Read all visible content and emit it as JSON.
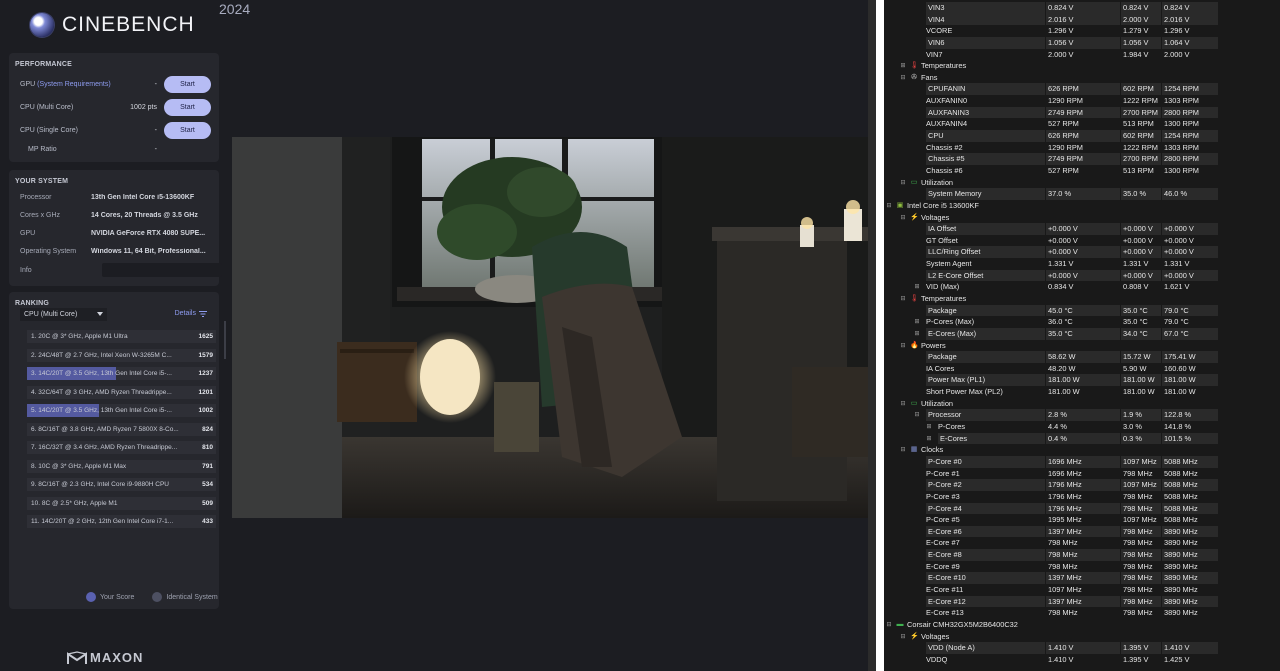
{
  "app": {
    "name": "CINEBENCH",
    "year": "2024",
    "footer_brand": "MAXON"
  },
  "performance": {
    "title": "PERFORMANCE",
    "rows": [
      {
        "label_prefix": "GPU ",
        "label_link": "(System Requirements)",
        "score": "-",
        "button": "Start"
      },
      {
        "label_prefix": "CPU (Multi Core)",
        "label_link": "",
        "score": "1002 pts",
        "button": "Start"
      },
      {
        "label_prefix": "CPU (Single Core)",
        "label_link": "",
        "score": "-",
        "button": "Start"
      },
      {
        "label_prefix": "MP Ratio",
        "label_link": "",
        "score": "-",
        "button": ""
      }
    ]
  },
  "system": {
    "title": "YOUR SYSTEM",
    "rows": [
      {
        "label": "Processor",
        "value": "13th Gen Intel Core i5-13600KF"
      },
      {
        "label": "Cores x GHz",
        "value": "14 Cores, 20 Threads @ 3.5 GHz"
      },
      {
        "label": "GPU",
        "value": "NVIDIA GeForce RTX 4080 SUPE..."
      },
      {
        "label": "Operating System",
        "value": "Windows 11, 64 Bit, Professional..."
      },
      {
        "label": "Info",
        "value": ""
      }
    ]
  },
  "ranking": {
    "title": "RANKING",
    "selected": "CPU (Multi Core)",
    "details": "Details",
    "max_score": 1625,
    "rows": [
      {
        "text": "1. 20C @ 3* GHz, Apple M1 Ultra",
        "score": "1625",
        "value": 1625,
        "mine": false
      },
      {
        "text": "2. 24C/48T @ 2.7 GHz, Intel Xeon W-3265M C...",
        "score": "1579",
        "value": 1579,
        "mine": false
      },
      {
        "text": "3. 14C/20T @ 3.5 GHz, 13th Gen Intel Core i5-...",
        "score": "1237",
        "value": 1237,
        "mine": true
      },
      {
        "text": "4. 32C/64T @ 3 GHz, AMD Ryzen Threadrippe...",
        "score": "1201",
        "value": 1201,
        "mine": false
      },
      {
        "text": "5. 14C/20T @ 3.5 GHz, 13th Gen Intel Core i5-...",
        "score": "1002",
        "value": 1002,
        "mine": true
      },
      {
        "text": "6. 8C/16T @ 3.8 GHz, AMD Ryzen 7 5800X 8-Co...",
        "score": "824",
        "value": 824,
        "mine": false
      },
      {
        "text": "7. 16C/32T @ 3.4 GHz, AMD Ryzen Threadrippe...",
        "score": "810",
        "value": 810,
        "mine": false
      },
      {
        "text": "8. 10C @ 3* GHz, Apple M1 Max",
        "score": "791",
        "value": 791,
        "mine": false
      },
      {
        "text": "9. 8C/16T @ 2.3 GHz, Intel Core i9-9880H CPU",
        "score": "534",
        "value": 534,
        "mine": false
      },
      {
        "text": "10. 8C @ 2.5* GHz, Apple M1",
        "score": "509",
        "value": 509,
        "mine": false
      },
      {
        "text": "11. 14C/20T @ 2 GHz, 12th Gen Intel Core i7-1...",
        "score": "433",
        "value": 433,
        "mine": false
      }
    ],
    "legend": {
      "your_score": "Your Score",
      "identical": "Identical System"
    }
  },
  "colors": {
    "accent": "#b6bcf4",
    "your_score": "#545aa0",
    "identical": "#6a6e86"
  },
  "sensors": [
    {
      "indent": 3,
      "name": "VIN3",
      "v1": "0.824 V",
      "v2": "0.824 V",
      "v3": "0.824 V",
      "hl": true
    },
    {
      "indent": 3,
      "name": "VIN4",
      "v1": "2.016 V",
      "v2": "2.000 V",
      "v3": "2.016 V",
      "hl": true
    },
    {
      "indent": 3,
      "name": "VCORE",
      "v1": "1.296 V",
      "v2": "1.279 V",
      "v3": "1.296 V",
      "hl": false
    },
    {
      "indent": 3,
      "name": "VIN6",
      "v1": "1.056 V",
      "v2": "1.056 V",
      "v3": "1.064 V",
      "hl": true
    },
    {
      "indent": 3,
      "name": "VIN7",
      "v1": "2.000 V",
      "v2": "1.984 V",
      "v3": "2.000 V",
      "hl": false
    },
    {
      "indent": 2,
      "name": "Temperatures",
      "group": true,
      "toggle": "+",
      "icon": "thermometer-icon",
      "glyph": "🌡",
      "color": "#e04040"
    },
    {
      "indent": 2,
      "name": "Fans",
      "group": true,
      "toggle": "−",
      "icon": "fan-icon",
      "glyph": "✇",
      "color": "#cccccc"
    },
    {
      "indent": 3,
      "name": "CPUFANIN",
      "v1": "626 RPM",
      "v2": "602 RPM",
      "v3": "1254 RPM",
      "hl": true
    },
    {
      "indent": 3,
      "name": "AUXFANIN0",
      "v1": "1290 RPM",
      "v2": "1222 RPM",
      "v3": "1303 RPM",
      "hl": false
    },
    {
      "indent": 3,
      "name": "AUXFANIN3",
      "v1": "2749 RPM",
      "v2": "2700 RPM",
      "v3": "2800 RPM",
      "hl": true
    },
    {
      "indent": 3,
      "name": "AUXFANIN4",
      "v1": "527 RPM",
      "v2": "513 RPM",
      "v3": "1300 RPM",
      "hl": false
    },
    {
      "indent": 3,
      "name": "CPU",
      "v1": "626 RPM",
      "v2": "602 RPM",
      "v3": "1254 RPM",
      "hl": true
    },
    {
      "indent": 3,
      "name": "Chassis #2",
      "v1": "1290 RPM",
      "v2": "1222 RPM",
      "v3": "1303 RPM",
      "hl": false
    },
    {
      "indent": 3,
      "name": "Chassis #5",
      "v1": "2749 RPM",
      "v2": "2700 RPM",
      "v3": "2800 RPM",
      "hl": true
    },
    {
      "indent": 3,
      "name": "Chassis #6",
      "v1": "527 RPM",
      "v2": "513 RPM",
      "v3": "1300 RPM",
      "hl": false
    },
    {
      "indent": 2,
      "name": "Utilization",
      "group": true,
      "toggle": "−",
      "icon": "utilization-icon",
      "glyph": "▭",
      "color": "#3fb04f"
    },
    {
      "indent": 3,
      "name": "System Memory",
      "v1": "37.0 %",
      "v2": "35.0 %",
      "v3": "46.0 %",
      "hl": true
    },
    {
      "indent": 1,
      "name": "Intel Core i5 13600KF",
      "group": true,
      "toggle": "−",
      "icon": "chip-icon",
      "glyph": "▣",
      "color": "#8fbf3f"
    },
    {
      "indent": 2,
      "name": "Voltages",
      "group": true,
      "toggle": "−",
      "icon": "voltage-icon",
      "glyph": "⚡",
      "color": "#f0c020"
    },
    {
      "indent": 3,
      "name": "IA Offset",
      "v1": "+0.000 V",
      "v2": "+0.000 V",
      "v3": "+0.000 V",
      "hl": true
    },
    {
      "indent": 3,
      "name": "GT Offset",
      "v1": "+0.000 V",
      "v2": "+0.000 V",
      "v3": "+0.000 V",
      "hl": false
    },
    {
      "indent": 3,
      "name": "LLC/Ring Offset",
      "v1": "+0.000 V",
      "v2": "+0.000 V",
      "v3": "+0.000 V",
      "hl": true
    },
    {
      "indent": 3,
      "name": "System Agent",
      "v1": "1.331 V",
      "v2": "1.331 V",
      "v3": "1.331 V",
      "hl": false
    },
    {
      "indent": 3,
      "name": "L2 E-Core Offset",
      "v1": "+0.000 V",
      "v2": "+0.000 V",
      "v3": "+0.000 V",
      "hl": true
    },
    {
      "indent": 3,
      "name": "VID (Max)",
      "toggle": "+",
      "v1": "0.834 V",
      "v2": "0.808 V",
      "v3": "1.621 V",
      "hl": false
    },
    {
      "indent": 2,
      "name": "Temperatures",
      "group": true,
      "toggle": "−",
      "icon": "thermometer-icon",
      "glyph": "🌡",
      "color": "#e04040"
    },
    {
      "indent": 3,
      "name": "Package",
      "v1": "45.0 °C",
      "v2": "35.0 °C",
      "v3": "79.0 °C",
      "hl": true
    },
    {
      "indent": 3,
      "name": "P-Cores (Max)",
      "toggle": "+",
      "v1": "36.0 °C",
      "v2": "35.0 °C",
      "v3": "79.0 °C",
      "hl": false
    },
    {
      "indent": 3,
      "name": "E-Cores (Max)",
      "toggle": "+",
      "v1": "35.0 °C",
      "v2": "34.0 °C",
      "v3": "67.0 °C",
      "hl": true
    },
    {
      "indent": 2,
      "name": "Powers",
      "group": true,
      "toggle": "−",
      "icon": "power-icon",
      "glyph": "🔥",
      "color": "#f08020"
    },
    {
      "indent": 3,
      "name": "Package",
      "v1": "58.62 W",
      "v2": "15.72 W",
      "v3": "175.41 W",
      "hl": true
    },
    {
      "indent": 3,
      "name": "IA Cores",
      "v1": "48.20 W",
      "v2": "5.90 W",
      "v3": "160.60 W",
      "hl": false
    },
    {
      "indent": 3,
      "name": "Power Max (PL1)",
      "v1": "181.00 W",
      "v2": "181.00 W",
      "v3": "181.00 W",
      "hl": true
    },
    {
      "indent": 3,
      "name": "Short Power Max (PL2)",
      "v1": "181.00 W",
      "v2": "181.00 W",
      "v3": "181.00 W",
      "hl": false
    },
    {
      "indent": 2,
      "name": "Utilization",
      "group": true,
      "toggle": "−",
      "icon": "utilization-icon",
      "glyph": "▭",
      "color": "#3fb04f"
    },
    {
      "indent": 3,
      "name": "Processor",
      "toggle": "−",
      "v1": "2.8 %",
      "v2": "1.9 %",
      "v3": "122.8 %",
      "hl": true
    },
    {
      "indent": 4,
      "name": "P-Cores",
      "toggle": "+",
      "v1": "4.4 %",
      "v2": "3.0 %",
      "v3": "141.8 %",
      "hl": false
    },
    {
      "indent": 4,
      "name": "E-Cores",
      "toggle": "+",
      "v1": "0.4 %",
      "v2": "0.3 %",
      "v3": "101.5 %",
      "hl": true
    },
    {
      "indent": 2,
      "name": "Clocks",
      "group": true,
      "toggle": "−",
      "icon": "clock-icon",
      "glyph": "▦",
      "color": "#8090d0"
    },
    {
      "indent": 3,
      "name": "P-Core #0",
      "v1": "1696 MHz",
      "v2": "1097 MHz",
      "v3": "5088 MHz",
      "hl": true
    },
    {
      "indent": 3,
      "name": "P-Core #1",
      "v1": "1696 MHz",
      "v2": "798 MHz",
      "v3": "5088 MHz",
      "hl": false
    },
    {
      "indent": 3,
      "name": "P-Core #2",
      "v1": "1796 MHz",
      "v2": "1097 MHz",
      "v3": "5088 MHz",
      "hl": true
    },
    {
      "indent": 3,
      "name": "P-Core #3",
      "v1": "1796 MHz",
      "v2": "798 MHz",
      "v3": "5088 MHz",
      "hl": false
    },
    {
      "indent": 3,
      "name": "P-Core #4",
      "v1": "1796 MHz",
      "v2": "798 MHz",
      "v3": "5088 MHz",
      "hl": true
    },
    {
      "indent": 3,
      "name": "P-Core #5",
      "v1": "1995 MHz",
      "v2": "1097 MHz",
      "v3": "5088 MHz",
      "hl": false
    },
    {
      "indent": 3,
      "name": "E-Core #6",
      "v1": "1397 MHz",
      "v2": "798 MHz",
      "v3": "3890 MHz",
      "hl": true
    },
    {
      "indent": 3,
      "name": "E-Core #7",
      "v1": "798 MHz",
      "v2": "798 MHz",
      "v3": "3890 MHz",
      "hl": false
    },
    {
      "indent": 3,
      "name": "E-Core #8",
      "v1": "798 MHz",
      "v2": "798 MHz",
      "v3": "3890 MHz",
      "hl": true
    },
    {
      "indent": 3,
      "name": "E-Core #9",
      "v1": "798 MHz",
      "v2": "798 MHz",
      "v3": "3890 MHz",
      "hl": false
    },
    {
      "indent": 3,
      "name": "E-Core #10",
      "v1": "1397 MHz",
      "v2": "798 MHz",
      "v3": "3890 MHz",
      "hl": true
    },
    {
      "indent": 3,
      "name": "E-Core #11",
      "v1": "1097 MHz",
      "v2": "798 MHz",
      "v3": "3890 MHz",
      "hl": false
    },
    {
      "indent": 3,
      "name": "E-Core #12",
      "v1": "1397 MHz",
      "v2": "798 MHz",
      "v3": "3890 MHz",
      "hl": true
    },
    {
      "indent": 3,
      "name": "E-Core #13",
      "v1": "798 MHz",
      "v2": "798 MHz",
      "v3": "3890 MHz",
      "hl": false
    },
    {
      "indent": 1,
      "name": "Corsair CMH32GX5M2B6400C32",
      "group": true,
      "toggle": "−",
      "icon": "memory-icon",
      "glyph": "▬",
      "color": "#3fb04f"
    },
    {
      "indent": 2,
      "name": "Voltages",
      "group": true,
      "toggle": "−",
      "icon": "voltage-icon",
      "glyph": "⚡",
      "color": "#f0c020"
    },
    {
      "indent": 3,
      "name": "VDD (Node A)",
      "v1": "1.410 V",
      "v2": "1.395 V",
      "v3": "1.410 V",
      "hl": true
    },
    {
      "indent": 3,
      "name": "VDDQ",
      "v1": "1.410 V",
      "v2": "1.395 V",
      "v3": "1.425 V",
      "hl": false
    }
  ]
}
